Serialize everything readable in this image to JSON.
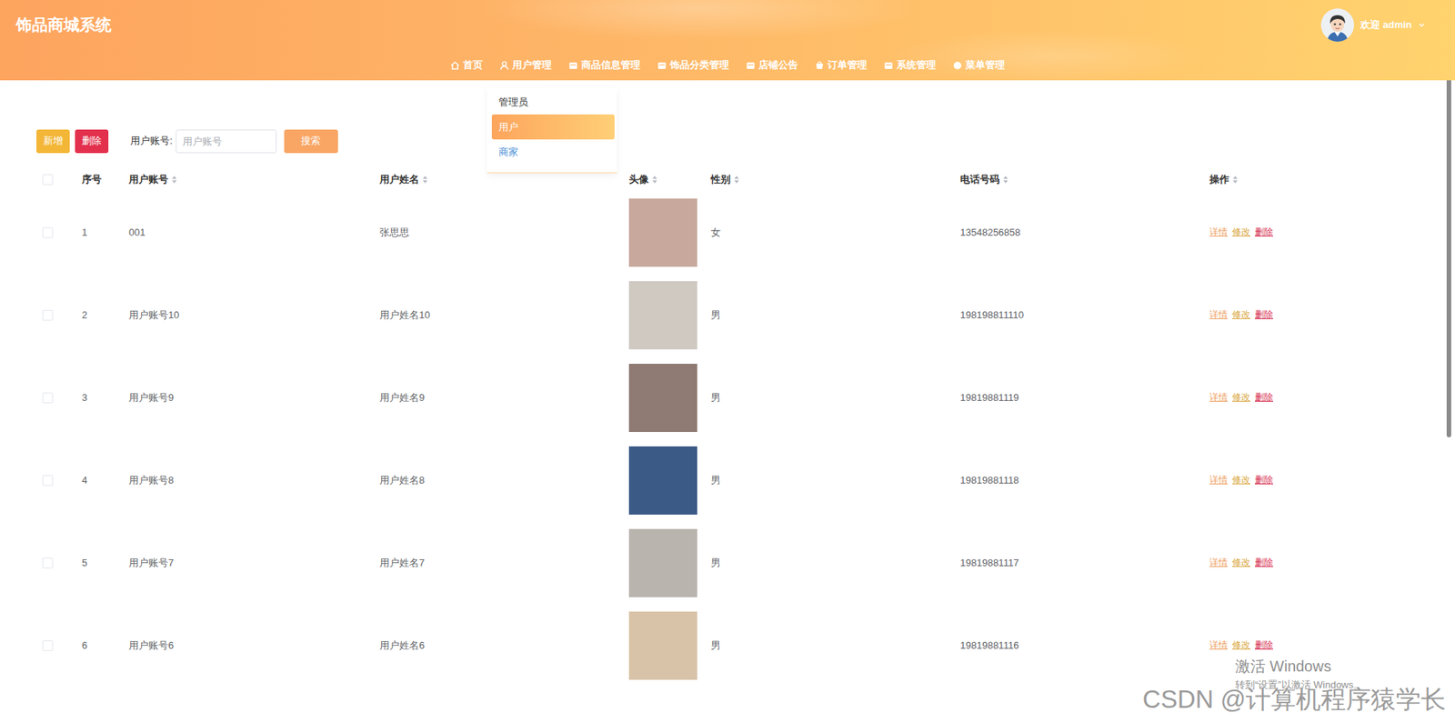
{
  "window": {
    "title": "饰品商城系统"
  },
  "user": {
    "greeting": "欢迎 admin"
  },
  "nav": [
    {
      "label": "首页",
      "expanded": false,
      "children": []
    },
    {
      "label": "用户管理",
      "expanded": true,
      "children": [
        {
          "label": "管理员",
          "selected": false,
          "color": "#333333"
        },
        {
          "label": "用户",
          "selected": true,
          "color": "#ffffff"
        },
        {
          "label": "商家",
          "selected": false,
          "color": "#4a8fd6"
        }
      ]
    },
    {
      "label": "商品信息管理",
      "expanded": false,
      "children": []
    },
    {
      "label": "饰品分类管理",
      "expanded": false,
      "children": []
    },
    {
      "label": "店铺公告",
      "expanded": false,
      "children": []
    },
    {
      "label": "订单管理",
      "expanded": false,
      "children": []
    },
    {
      "label": "系统管理",
      "expanded": false,
      "children": []
    },
    {
      "label": "菜单管理",
      "expanded": false,
      "children": []
    }
  ],
  "toolbar": {
    "add": "新增",
    "delete": "删除",
    "search_label": "用户账号:",
    "search_placeholder": "用户账号",
    "search_button": "搜索"
  },
  "table": {
    "columns": [
      {
        "label": "",
        "kind": "checkbox",
        "sortable": false,
        "checked": false
      },
      {
        "label": "序号",
        "kind": "text",
        "sortable": false,
        "checked": false
      },
      {
        "label": "用户账号",
        "kind": "text",
        "sortable": true,
        "checked": false
      },
      {
        "label": "用户姓名",
        "kind": "text",
        "sortable": true,
        "checked": false
      },
      {
        "label": "头像",
        "kind": "text",
        "sortable": true,
        "checked": false
      },
      {
        "label": "性别",
        "kind": "text",
        "sortable": true,
        "checked": false
      },
      {
        "label": "电话号码",
        "kind": "text",
        "sortable": true,
        "checked": false
      },
      {
        "label": "操作",
        "kind": "text",
        "sortable": true,
        "checked": false
      }
    ],
    "actions": [
      {
        "label": "详情",
        "kind": "detail"
      },
      {
        "label": "修改",
        "kind": "edit"
      },
      {
        "label": "删除",
        "kind": "delete"
      }
    ],
    "rows": [
      {
        "index": "1",
        "account": "001",
        "name": "张思思",
        "gender": "女",
        "phone": "13548256858",
        "checked": false
      },
      {
        "index": "2",
        "account": "用户账号10",
        "name": "用户姓名10",
        "gender": "男",
        "phone": "198198811110",
        "checked": false
      },
      {
        "index": "3",
        "account": "用户账号9",
        "name": "用户姓名9",
        "gender": "男",
        "phone": "19819881119",
        "checked": false
      },
      {
        "index": "4",
        "account": "用户账号8",
        "name": "用户姓名8",
        "gender": "男",
        "phone": "19819881118",
        "checked": false
      },
      {
        "index": "5",
        "account": "用户账号7",
        "name": "用户姓名7",
        "gender": "男",
        "phone": "19819881117",
        "checked": false
      },
      {
        "index": "6",
        "account": "用户账号6",
        "name": "用户姓名6",
        "gender": "男",
        "phone": "19819881116",
        "checked": false
      }
    ]
  },
  "overlay": {
    "activate_title": "激活 Windows",
    "activate_hint": "转到“设置”以激活 Windows。",
    "credit": "CSDN @计算机程序猿学长"
  }
}
